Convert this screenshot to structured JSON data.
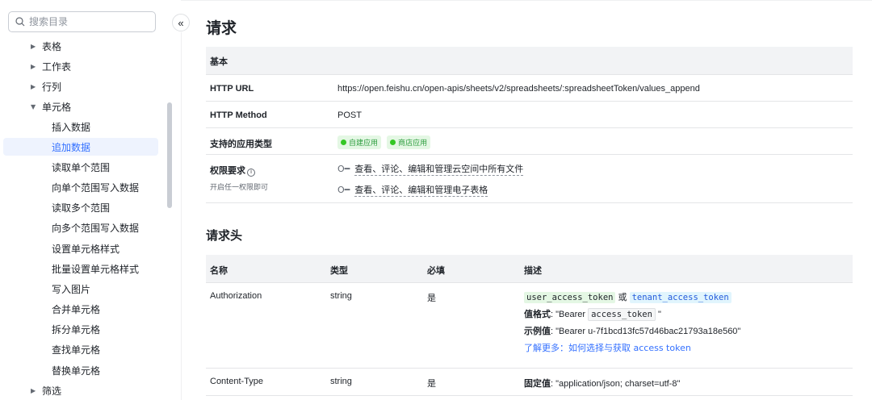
{
  "sidebar": {
    "search_placeholder": "搜索目录",
    "items": [
      {
        "label": "表格"
      },
      {
        "label": "工作表"
      },
      {
        "label": "行列"
      },
      {
        "label": "单元格"
      },
      {
        "label": "插入数据"
      },
      {
        "label": "追加数据"
      },
      {
        "label": "读取单个范围"
      },
      {
        "label": "向单个范围写入数据"
      },
      {
        "label": "读取多个范围"
      },
      {
        "label": "向多个范围写入数据"
      },
      {
        "label": "设置单元格样式"
      },
      {
        "label": "批量设置单元格样式"
      },
      {
        "label": "写入图片"
      },
      {
        "label": "合并单元格"
      },
      {
        "label": "拆分单元格"
      },
      {
        "label": "查找单元格"
      },
      {
        "label": "替换单元格"
      },
      {
        "label": "筛选"
      }
    ],
    "collapse_glyph": "«"
  },
  "main": {
    "request_title": "请求",
    "basic": {
      "header": "基本",
      "url_key": "HTTP URL",
      "url_value": "https://open.feishu.cn/open-apis/sheets/v2/spreadsheets/:spreadsheetToken/values_append",
      "method_key": "HTTP Method",
      "method_value": "POST",
      "app_type_key": "支持的应用类型",
      "app_tags": [
        "自建应用",
        "商店应用"
      ],
      "perm_key": "权限要求",
      "perm_sub": "开启任一权限即可",
      "perms": [
        "查看、评论、编辑和管理云空间中所有文件",
        "查看、评论、编辑和管理电子表格"
      ]
    },
    "headers_title": "请求头",
    "headers_table": {
      "columns": [
        "名称",
        "类型",
        "必填",
        "描述"
      ],
      "auth": {
        "name": "Authorization",
        "type": "string",
        "required": "是",
        "token_a": "user_access_token",
        "or": "或",
        "token_b": "tenant_access_token",
        "format_label": "值格式",
        "format_prefix": ": \"Bearer ",
        "format_code": "access_token",
        "format_suffix": " \"",
        "example_label": "示例值",
        "example_value": ": \"Bearer u-7f1bcd13fc57d46bac21793a18e560\"",
        "learn_more": "了解更多：如何选择与获取 access token"
      },
      "content_type": {
        "name": "Content-Type",
        "type": "string",
        "required": "是",
        "fixed_label": "固定值",
        "fixed_value": ": \"application/json; charset=utf-8\""
      }
    }
  },
  "colors": {
    "accent": "#3370ff",
    "active_bg": "#eef3fe",
    "table_head_bg": "#f2f3f5",
    "tag_green": "#34c724"
  }
}
